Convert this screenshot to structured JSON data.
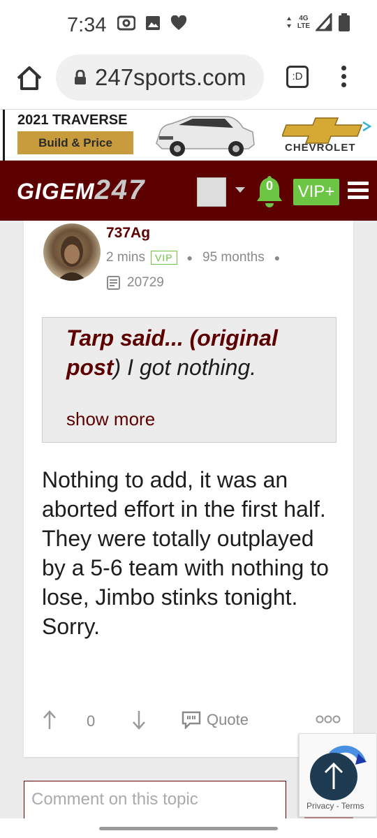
{
  "status_bar": {
    "time": "7:34",
    "network_top": "4G",
    "network_bottom": "LTE"
  },
  "browser": {
    "url": "247sports.com",
    "tabs_label": ":D"
  },
  "ad": {
    "title": "2021 TRAVERSE",
    "button_label": "Build & Price",
    "brand": "CHEVROLET"
  },
  "header": {
    "logo_text": "GIGEM",
    "logo_num": "247",
    "notification_count": "0",
    "vip_label": "VIP+"
  },
  "post": {
    "username": "737Ag",
    "time_ago": "2 mins",
    "vip_badge": "VIP",
    "tenure": "95 months",
    "post_count": "20729",
    "quote": {
      "author_part": "Tarp said... (original post",
      "close_paren": ")",
      "text": " I got nothing.",
      "show_more": "show more"
    },
    "body": "Nothing to add, it was an aborted effort in the first half. They were totally outplayed by a 5-6 team with nothing to lose, Jimbo stinks tonight. Sorry.",
    "vote_count": "0",
    "quote_label": "Quote"
  },
  "comment": {
    "placeholder": "Comment on this topic"
  },
  "recaptcha": {
    "text": "Privacy - Terms"
  },
  "colors": {
    "brand_maroon": "#5c0000",
    "vip_green": "#6cc644",
    "meta_gray": "#8a8a8a"
  }
}
